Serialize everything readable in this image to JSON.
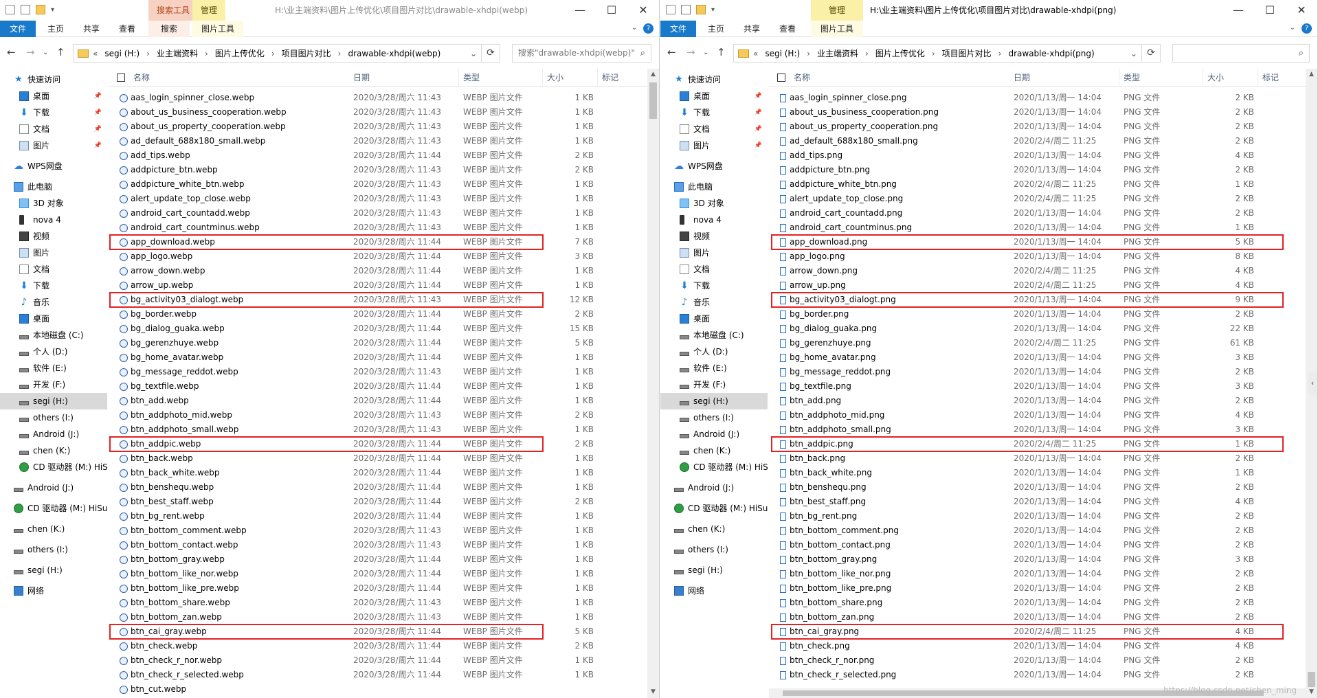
{
  "left": {
    "ctx_label": "搜索工具",
    "ctx2_label": "管理",
    "window_title": "H:\\业主端资料\\图片上传优化\\项目图片对比\\drawable-xhdpi(webp)",
    "ribbon": {
      "file": "文件",
      "home": "主页",
      "share": "共享",
      "view": "查看",
      "search": "搜索",
      "picture_tools": "图片工具"
    },
    "address": {
      "prefix": "«",
      "crumbs": [
        "segi (H:)",
        "业主端资料",
        "图片上传优化",
        "项目图片对比",
        "drawable-xhdpi(webp)"
      ]
    },
    "search_placeholder": "搜索\"drawable-xhdpi(webp)\"",
    "columns": {
      "name": "名称",
      "date": "日期",
      "type": "类型",
      "size": "大小",
      "tags": "标记"
    },
    "files": [
      {
        "name": "aas_login_spinner_close.webp",
        "date": "2020/3/28/周六 11:43",
        "type": "WEBP 图片文件",
        "size": "1 KB"
      },
      {
        "name": "about_us_business_cooperation.webp",
        "date": "2020/3/28/周六 11:43",
        "type": "WEBP 图片文件",
        "size": "1 KB"
      },
      {
        "name": "about_us_property_cooperation.webp",
        "date": "2020/3/28/周六 11:43",
        "type": "WEBP 图片文件",
        "size": "1 KB"
      },
      {
        "name": "ad_default_688x180_small.webp",
        "date": "2020/3/28/周六 11:43",
        "type": "WEBP 图片文件",
        "size": "1 KB"
      },
      {
        "name": "add_tips.webp",
        "date": "2020/3/28/周六 11:44",
        "type": "WEBP 图片文件",
        "size": "2 KB"
      },
      {
        "name": "addpicture_btn.webp",
        "date": "2020/3/28/周六 11:43",
        "type": "WEBP 图片文件",
        "size": "2 KB"
      },
      {
        "name": "addpicture_white_btn.webp",
        "date": "2020/3/28/周六 11:43",
        "type": "WEBP 图片文件",
        "size": "1 KB"
      },
      {
        "name": "alert_update_top_close.webp",
        "date": "2020/3/28/周六 11:43",
        "type": "WEBP 图片文件",
        "size": "1 KB"
      },
      {
        "name": "android_cart_countadd.webp",
        "date": "2020/3/28/周六 11:43",
        "type": "WEBP 图片文件",
        "size": "1 KB"
      },
      {
        "name": "android_cart_countminus.webp",
        "date": "2020/3/28/周六 11:43",
        "type": "WEBP 图片文件",
        "size": "1 KB"
      },
      {
        "name": "app_download.webp",
        "date": "2020/3/28/周六 11:44",
        "type": "WEBP 图片文件",
        "size": "7 KB",
        "hl": true
      },
      {
        "name": "app_logo.webp",
        "date": "2020/3/28/周六 11:44",
        "type": "WEBP 图片文件",
        "size": "3 KB"
      },
      {
        "name": "arrow_down.webp",
        "date": "2020/3/28/周六 11:44",
        "type": "WEBP 图片文件",
        "size": "1 KB"
      },
      {
        "name": "arrow_up.webp",
        "date": "2020/3/28/周六 11:44",
        "type": "WEBP 图片文件",
        "size": "1 KB"
      },
      {
        "name": "bg_activity03_dialogt.webp",
        "date": "2020/3/28/周六 11:43",
        "type": "WEBP 图片文件",
        "size": "12 KB",
        "hl": true
      },
      {
        "name": "bg_border.webp",
        "date": "2020/3/28/周六 11:44",
        "type": "WEBP 图片文件",
        "size": "2 KB"
      },
      {
        "name": "bg_dialog_guaka.webp",
        "date": "2020/3/28/周六 11:44",
        "type": "WEBP 图片文件",
        "size": "15 KB"
      },
      {
        "name": "bg_gerenzhuye.webp",
        "date": "2020/3/28/周六 11:44",
        "type": "WEBP 图片文件",
        "size": "5 KB"
      },
      {
        "name": "bg_home_avatar.webp",
        "date": "2020/3/28/周六 11:44",
        "type": "WEBP 图片文件",
        "size": "1 KB"
      },
      {
        "name": "bg_message_reddot.webp",
        "date": "2020/3/28/周六 11:43",
        "type": "WEBP 图片文件",
        "size": "1 KB"
      },
      {
        "name": "bg_textfile.webp",
        "date": "2020/3/28/周六 11:44",
        "type": "WEBP 图片文件",
        "size": "1 KB"
      },
      {
        "name": "btn_add.webp",
        "date": "2020/3/28/周六 11:44",
        "type": "WEBP 图片文件",
        "size": "1 KB"
      },
      {
        "name": "btn_addphoto_mid.webp",
        "date": "2020/3/28/周六 11:43",
        "type": "WEBP 图片文件",
        "size": "2 KB"
      },
      {
        "name": "btn_addphoto_small.webp",
        "date": "2020/3/28/周六 11:43",
        "type": "WEBP 图片文件",
        "size": "1 KB"
      },
      {
        "name": "btn_addpic.webp",
        "date": "2020/3/28/周六 11:44",
        "type": "WEBP 图片文件",
        "size": "2 KB",
        "hl": true
      },
      {
        "name": "btn_back.webp",
        "date": "2020/3/28/周六 11:44",
        "type": "WEBP 图片文件",
        "size": "1 KB"
      },
      {
        "name": "btn_back_white.webp",
        "date": "2020/3/28/周六 11:44",
        "type": "WEBP 图片文件",
        "size": "1 KB"
      },
      {
        "name": "btn_benshequ.webp",
        "date": "2020/3/28/周六 11:44",
        "type": "WEBP 图片文件",
        "size": "1 KB"
      },
      {
        "name": "btn_best_staff.webp",
        "date": "2020/3/28/周六 11:44",
        "type": "WEBP 图片文件",
        "size": "2 KB"
      },
      {
        "name": "btn_bg_rent.webp",
        "date": "2020/3/28/周六 11:44",
        "type": "WEBP 图片文件",
        "size": "1 KB"
      },
      {
        "name": "btn_bottom_comment.webp",
        "date": "2020/3/28/周六 11:43",
        "type": "WEBP 图片文件",
        "size": "1 KB"
      },
      {
        "name": "btn_bottom_contact.webp",
        "date": "2020/3/28/周六 11:43",
        "type": "WEBP 图片文件",
        "size": "1 KB"
      },
      {
        "name": "btn_bottom_gray.webp",
        "date": "2020/3/28/周六 11:44",
        "type": "WEBP 图片文件",
        "size": "1 KB"
      },
      {
        "name": "btn_bottom_like_nor.webp",
        "date": "2020/3/28/周六 11:44",
        "type": "WEBP 图片文件",
        "size": "1 KB"
      },
      {
        "name": "btn_bottom_like_pre.webp",
        "date": "2020/3/28/周六 11:44",
        "type": "WEBP 图片文件",
        "size": "1 KB"
      },
      {
        "name": "btn_bottom_share.webp",
        "date": "2020/3/28/周六 11:43",
        "type": "WEBP 图片文件",
        "size": "1 KB"
      },
      {
        "name": "btn_bottom_zan.webp",
        "date": "2020/3/28/周六 11:43",
        "type": "WEBP 图片文件",
        "size": "1 KB"
      },
      {
        "name": "btn_cai_gray.webp",
        "date": "2020/3/28/周六 11:44",
        "type": "WEBP 图片文件",
        "size": "5 KB",
        "hl": true
      },
      {
        "name": "btn_check.webp",
        "date": "2020/3/28/周六 11:44",
        "type": "WEBP 图片文件",
        "size": "2 KB"
      },
      {
        "name": "btn_check_r_nor.webp",
        "date": "2020/3/28/周六 11:44",
        "type": "WEBP 图片文件",
        "size": "1 KB"
      },
      {
        "name": "btn_check_r_selected.webp",
        "date": "2020/3/28/周六 11:44",
        "type": "WEBP 图片文件",
        "size": "1 KB"
      },
      {
        "name": "btn_cut.webp",
        "date": "",
        "type": "",
        "size": ""
      }
    ]
  },
  "right": {
    "ctx2_label": "管理",
    "window_title": "H:\\业主端资料\\图片上传优化\\项目图片对比\\drawable-xhdpi(png)",
    "ribbon": {
      "file": "文件",
      "home": "主页",
      "share": "共享",
      "view": "查看",
      "picture_tools": "图片工具"
    },
    "address": {
      "prefix": "«",
      "crumbs": [
        "segi (H:)",
        "业主端资料",
        "图片上传优化",
        "项目图片对比",
        "drawable-xhdpi(png)"
      ]
    },
    "columns": {
      "name": "名称",
      "date": "日期",
      "type": "类型",
      "size": "大小",
      "tags": "标记"
    },
    "files": [
      {
        "name": "aas_login_spinner_close.png",
        "date": "2020/1/13/周一 14:04",
        "type": "PNG 文件",
        "size": "2 KB"
      },
      {
        "name": "about_us_business_cooperation.png",
        "date": "2020/1/13/周一 14:04",
        "type": "PNG 文件",
        "size": "2 KB"
      },
      {
        "name": "about_us_property_cooperation.png",
        "date": "2020/1/13/周一 14:04",
        "type": "PNG 文件",
        "size": "2 KB"
      },
      {
        "name": "ad_default_688x180_small.png",
        "date": "2020/2/4/周二 11:25",
        "type": "PNG 文件",
        "size": "2 KB"
      },
      {
        "name": "add_tips.png",
        "date": "2020/1/13/周一 14:04",
        "type": "PNG 文件",
        "size": "4 KB"
      },
      {
        "name": "addpicture_btn.png",
        "date": "2020/1/13/周一 14:04",
        "type": "PNG 文件",
        "size": "2 KB"
      },
      {
        "name": "addpicture_white_btn.png",
        "date": "2020/2/4/周二 11:25",
        "type": "PNG 文件",
        "size": "1 KB"
      },
      {
        "name": "alert_update_top_close.png",
        "date": "2020/2/4/周二 11:25",
        "type": "PNG 文件",
        "size": "2 KB"
      },
      {
        "name": "android_cart_countadd.png",
        "date": "2020/1/13/周一 14:04",
        "type": "PNG 文件",
        "size": "2 KB"
      },
      {
        "name": "android_cart_countminus.png",
        "date": "2020/1/13/周一 14:04",
        "type": "PNG 文件",
        "size": "1 KB"
      },
      {
        "name": "app_download.png",
        "date": "2020/1/13/周一 14:04",
        "type": "PNG 文件",
        "size": "5 KB",
        "hl": true
      },
      {
        "name": "app_logo.png",
        "date": "2020/1/13/周一 14:04",
        "type": "PNG 文件",
        "size": "8 KB"
      },
      {
        "name": "arrow_down.png",
        "date": "2020/2/4/周二 11:25",
        "type": "PNG 文件",
        "size": "4 KB"
      },
      {
        "name": "arrow_up.png",
        "date": "2020/2/4/周二 11:25",
        "type": "PNG 文件",
        "size": "4 KB"
      },
      {
        "name": "bg_activity03_dialogt.png",
        "date": "2020/1/13/周一 14:04",
        "type": "PNG 文件",
        "size": "9 KB",
        "hl": true
      },
      {
        "name": "bg_border.png",
        "date": "2020/1/13/周一 14:04",
        "type": "PNG 文件",
        "size": "2 KB"
      },
      {
        "name": "bg_dialog_guaka.png",
        "date": "2020/1/13/周一 14:04",
        "type": "PNG 文件",
        "size": "22 KB"
      },
      {
        "name": "bg_gerenzhuye.png",
        "date": "2020/2/4/周二 11:25",
        "type": "PNG 文件",
        "size": "61 KB"
      },
      {
        "name": "bg_home_avatar.png",
        "date": "2020/1/13/周一 14:04",
        "type": "PNG 文件",
        "size": "3 KB"
      },
      {
        "name": "bg_message_reddot.png",
        "date": "2020/1/13/周一 14:04",
        "type": "PNG 文件",
        "size": "2 KB"
      },
      {
        "name": "bg_textfile.png",
        "date": "2020/1/13/周一 14:04",
        "type": "PNG 文件",
        "size": "3 KB"
      },
      {
        "name": "btn_add.png",
        "date": "2020/1/13/周一 14:04",
        "type": "PNG 文件",
        "size": "2 KB"
      },
      {
        "name": "btn_addphoto_mid.png",
        "date": "2020/1/13/周一 14:04",
        "type": "PNG 文件",
        "size": "4 KB"
      },
      {
        "name": "btn_addphoto_small.png",
        "date": "2020/1/13/周一 14:04",
        "type": "PNG 文件",
        "size": "3 KB"
      },
      {
        "name": "btn_addpic.png",
        "date": "2020/2/4/周二 11:25",
        "type": "PNG 文件",
        "size": "1 KB",
        "hl": true
      },
      {
        "name": "btn_back.png",
        "date": "2020/1/13/周一 14:04",
        "type": "PNG 文件",
        "size": "2 KB"
      },
      {
        "name": "btn_back_white.png",
        "date": "2020/1/13/周一 14:04",
        "type": "PNG 文件",
        "size": "1 KB"
      },
      {
        "name": "btn_benshequ.png",
        "date": "2020/1/13/周一 14:04",
        "type": "PNG 文件",
        "size": "2 KB"
      },
      {
        "name": "btn_best_staff.png",
        "date": "2020/1/13/周一 14:04",
        "type": "PNG 文件",
        "size": "4 KB"
      },
      {
        "name": "btn_bg_rent.png",
        "date": "2020/1/13/周一 14:04",
        "type": "PNG 文件",
        "size": "2 KB"
      },
      {
        "name": "btn_bottom_comment.png",
        "date": "2020/1/13/周一 14:04",
        "type": "PNG 文件",
        "size": "2 KB"
      },
      {
        "name": "btn_bottom_contact.png",
        "date": "2020/1/13/周一 14:04",
        "type": "PNG 文件",
        "size": "2 KB"
      },
      {
        "name": "btn_bottom_gray.png",
        "date": "2020/1/13/周一 14:04",
        "type": "PNG 文件",
        "size": "3 KB"
      },
      {
        "name": "btn_bottom_like_nor.png",
        "date": "2020/1/13/周一 14:04",
        "type": "PNG 文件",
        "size": "2 KB"
      },
      {
        "name": "btn_bottom_like_pre.png",
        "date": "2020/1/13/周一 14:04",
        "type": "PNG 文件",
        "size": "2 KB"
      },
      {
        "name": "btn_bottom_share.png",
        "date": "2020/1/13/周一 14:04",
        "type": "PNG 文件",
        "size": "2 KB"
      },
      {
        "name": "btn_bottom_zan.png",
        "date": "2020/1/13/周一 14:04",
        "type": "PNG 文件",
        "size": "2 KB"
      },
      {
        "name": "btn_cai_gray.png",
        "date": "2020/2/4/周二 11:25",
        "type": "PNG 文件",
        "size": "4 KB",
        "hl": true
      },
      {
        "name": "btn_check.png",
        "date": "2020/1/13/周一 14:04",
        "type": "PNG 文件",
        "size": "4 KB"
      },
      {
        "name": "btn_check_r_nor.png",
        "date": "2020/1/13/周一 14:04",
        "type": "PNG 文件",
        "size": "2 KB"
      },
      {
        "name": "btn_check_r_selected.png",
        "date": "2020/1/13/周一 14:04",
        "type": "PNG 文件",
        "size": "2 KB"
      }
    ]
  },
  "nav_left": [
    {
      "label": "快速访问",
      "icon": "star-icon",
      "pin": false
    },
    {
      "label": "桌面",
      "icon": "desktop-icon",
      "pin": true
    },
    {
      "label": "下载",
      "icon": "download-icon",
      "pin": true
    },
    {
      "label": "文档",
      "icon": "document-icon",
      "pin": true
    },
    {
      "label": "图片",
      "icon": "picture-icon",
      "pin": true
    },
    {
      "label": "WPS网盘",
      "icon": "cloud-icon",
      "pin": false
    },
    {
      "label": "此电脑",
      "icon": "computer-icon",
      "pin": false
    },
    {
      "label": "3D 对象",
      "icon": "3d-object-icon",
      "pin": false
    },
    {
      "label": "nova 4",
      "icon": "phone-icon",
      "pin": false
    },
    {
      "label": "视频",
      "icon": "video-icon",
      "pin": false
    },
    {
      "label": "图片",
      "icon": "picture-icon",
      "pin": false
    },
    {
      "label": "文档",
      "icon": "document-icon",
      "pin": false
    },
    {
      "label": "下载",
      "icon": "download-icon",
      "pin": false
    },
    {
      "label": "音乐",
      "icon": "music-icon",
      "pin": false
    },
    {
      "label": "桌面",
      "icon": "desktop-icon",
      "pin": false
    },
    {
      "label": "本地磁盘 (C:)",
      "icon": "drive-icon",
      "pin": false
    },
    {
      "label": "个人 (D:)",
      "icon": "drive-icon",
      "pin": false
    },
    {
      "label": "软件 (E:)",
      "icon": "drive-icon",
      "pin": false
    },
    {
      "label": "开发 (F:)",
      "icon": "drive-icon",
      "pin": false
    },
    {
      "label": "segi (H:)",
      "icon": "drive-icon",
      "pin": false,
      "selected": true
    },
    {
      "label": "others (I:)",
      "icon": "drive-icon",
      "pin": false
    },
    {
      "label": "Android (J:)",
      "icon": "drive-icon",
      "pin": false
    },
    {
      "label": "chen (K:)",
      "icon": "drive-icon",
      "pin": false
    },
    {
      "label": "CD 驱动器 (M:) HiS",
      "icon": "cd-drive-icon",
      "pin": false
    },
    {
      "label": "Android (J:)",
      "icon": "drive-icon",
      "pin": false
    },
    {
      "label": "CD 驱动器 (M:) HiSu",
      "icon": "cd-drive-icon",
      "pin": false
    },
    {
      "label": "chen (K:)",
      "icon": "drive-icon",
      "pin": false
    },
    {
      "label": "others (I:)",
      "icon": "drive-icon",
      "pin": false
    },
    {
      "label": "segi (H:)",
      "icon": "drive-icon",
      "pin": false
    },
    {
      "label": "网络",
      "icon": "network-icon",
      "pin": false
    }
  ],
  "watermark": "https://blog.csdn.net/chen_ming"
}
